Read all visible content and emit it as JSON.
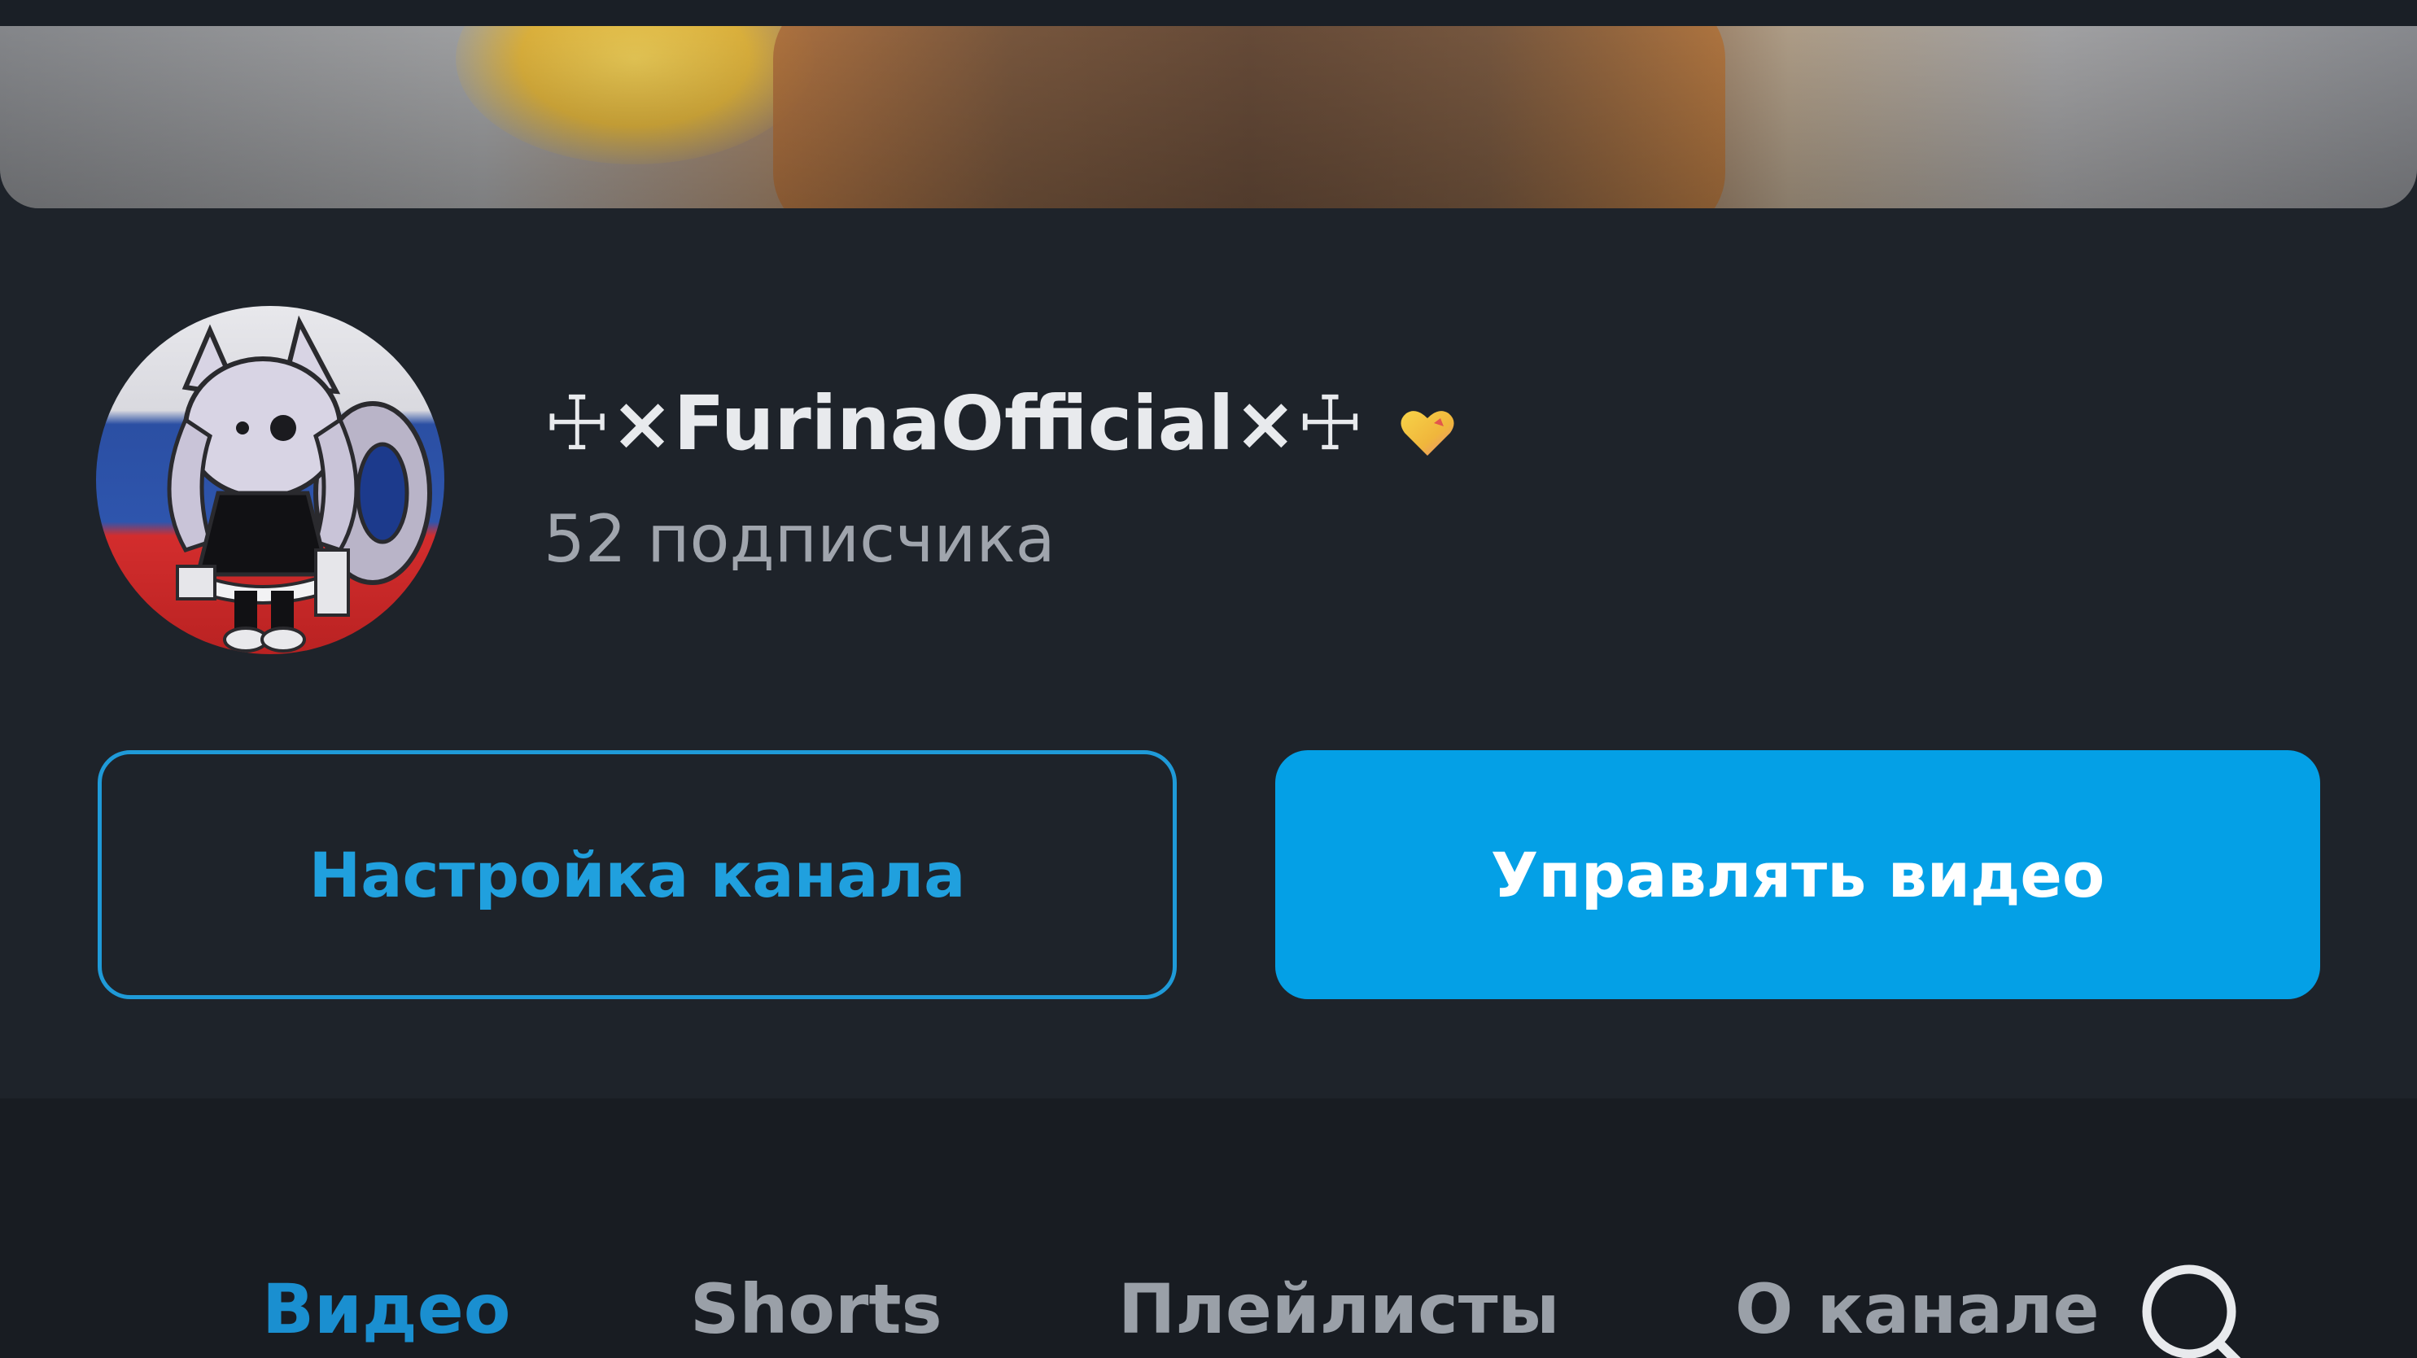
{
  "channel": {
    "name": "☩×FurinaOfficial×☩",
    "subscribers": "52 подписчика",
    "avatar_icon": "avatar-image",
    "badge_icon": "heart-icon"
  },
  "actions": {
    "settings_label": "Настройка канала",
    "manage_label": "Управлять видео"
  },
  "tabs": [
    {
      "label": "Видео",
      "active": true
    },
    {
      "label": "Shorts",
      "active": false
    },
    {
      "label": "Плейлисты",
      "active": false
    },
    {
      "label": "О канале",
      "active": false
    }
  ],
  "search": {
    "icon": "search-icon"
  },
  "colors": {
    "background": "#1e232a",
    "accent": "#04a0e6",
    "active_tab": "#1a8fd0",
    "muted_text": "#a0a5ad"
  }
}
